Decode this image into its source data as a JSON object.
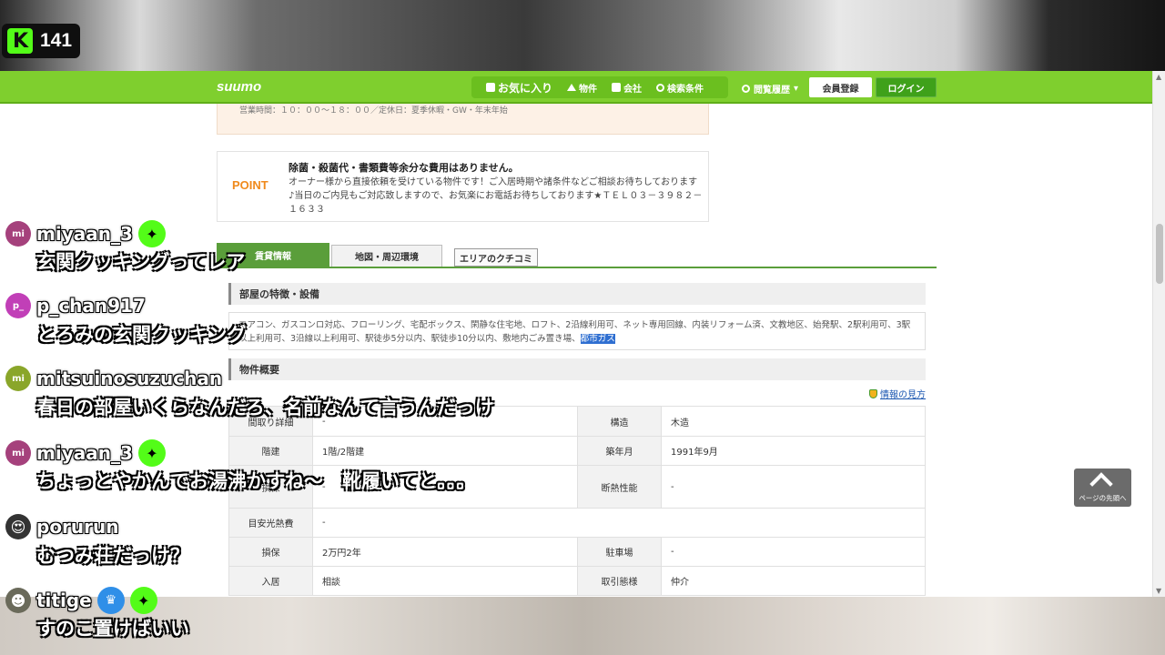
{
  "stream": {
    "viewer_count": "141"
  },
  "header": {
    "logo": "suumo",
    "nav": [
      {
        "label": "お気に入り",
        "icon": "favorites-icon"
      },
      {
        "label": "物件",
        "icon": "house-icon"
      },
      {
        "label": "会社",
        "icon": "building-icon"
      },
      {
        "label": "検索条件",
        "icon": "search-icon"
      }
    ],
    "history_label": "閲覧履歴",
    "register_label": "会員登録",
    "login_label": "ログイン"
  },
  "content": {
    "hours_text": "営業時間：１０：００〜１８：００／定休日：夏季休暇・GW・年末年始",
    "point": {
      "label": "POINT",
      "title": "除菌・殺菌代・書類費等余分な費用はありません。",
      "body": "オーナー様から直接依頼を受けている物件です！ご入居時期や諸条件などご相談お待ちしております♪当日のご内見もご対応致しますので、お気楽にお電話お待ちしております★ＴＥＬ０３－３９８２－１６３３"
    },
    "tabs": [
      "賃貸情報",
      "地図・周辺環境",
      "エリアのクチコミ"
    ],
    "features_heading": "部屋の特徴・設備",
    "features_text": "エアコン、ガスコンロ対応、フローリング、宅配ボックス、閑静な住宅地、ロフト、2沿線利用可、ネット専用回線、内装リフォーム済、文教地区、始発駅、2駅利用可、3駅以上利用可、3沿線以上利用可、駅徒歩5分以内、駅徒歩10分以内、敷地内ごみ置き場、",
    "features_highlight": "都市ガス",
    "overview_heading": "物件概要",
    "help_link": "情報の見方",
    "spec_rows": [
      {
        "k1": "間取り詳細",
        "v1": "-",
        "k2": "構造",
        "v2": "木造"
      },
      {
        "k1": "階建",
        "v1": "1階/2階建",
        "k2": "築年月",
        "v2": "1991年9月"
      },
      {
        "k1": "損保",
        "v1": "-",
        "k2": "断熱性能",
        "v2": "-"
      },
      {
        "k1": "目安光熱費",
        "v1": "-"
      },
      {
        "k1": "損保",
        "v1": "2万円2年",
        "k2": "駐車場",
        "v2": "-"
      },
      {
        "k1": "入居",
        "v1": "相談",
        "k2": "取引態様",
        "v2": "仲介"
      }
    ],
    "page_top_label": "ページの先頭へ"
  },
  "chat": [
    {
      "user": "miyaan_3",
      "avatar": "mi",
      "avatar_color": "#a5417c",
      "badges": [
        "green"
      ],
      "text": "玄関クッキングってレア"
    },
    {
      "user": "p_chan917",
      "avatar": "p_",
      "avatar_color": "#c13fb7",
      "badges": [],
      "text": "とろみの玄関クッキング"
    },
    {
      "user": "mitsuinosuzuchan",
      "avatar": "mi",
      "avatar_color": "#8aa62a",
      "badges": [],
      "text": "春日の部屋いくらなんだろ、名前なんて言うんだっけ"
    },
    {
      "user": "miyaan_3",
      "avatar": "mi",
      "avatar_color": "#a5417c",
      "badges": [
        "green"
      ],
      "text": "ちょっとやかんでお湯沸かすね〜　靴履いてと。。。"
    },
    {
      "user": "porurun",
      "avatar": "😍",
      "avatar_color": "#333333",
      "badges": [],
      "text": "むつみ荘だっけ？"
    },
    {
      "user": "titige",
      "avatar": "☻",
      "avatar_color": "#6a6a5a",
      "badges": [
        "blue",
        "green"
      ],
      "text": "すのこ置けばいい"
    }
  ]
}
